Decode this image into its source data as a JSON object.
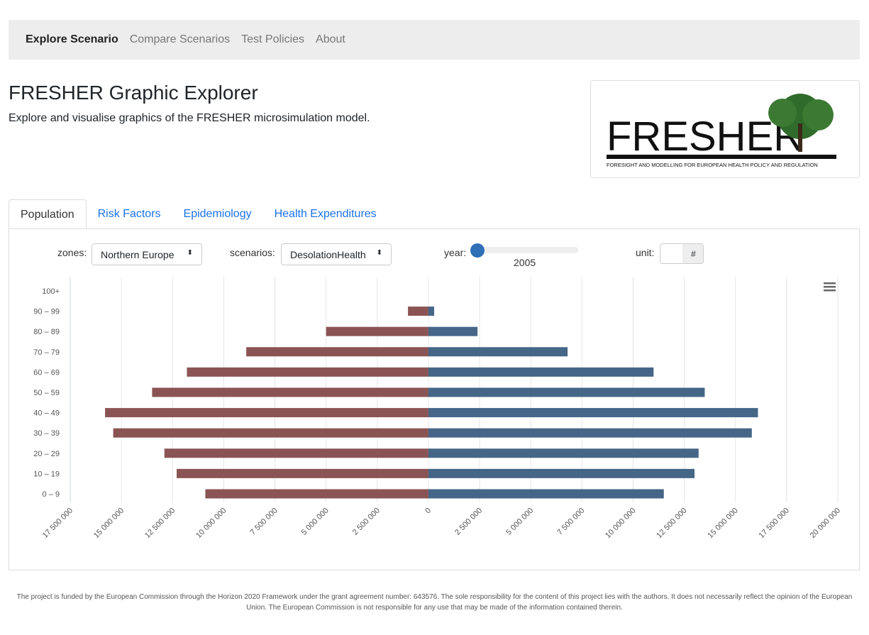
{
  "nav": {
    "items": [
      {
        "label": "Explore Scenario",
        "active": true
      },
      {
        "label": "Compare Scenarios"
      },
      {
        "label": "Test Policies"
      },
      {
        "label": "About"
      }
    ]
  },
  "header": {
    "title": "FRESHER Graphic Explorer",
    "subtitle": "Explore and visualise graphics of the FRESHER microsimulation model.",
    "logo_text": "FRESHER",
    "logo_tagline": "FORESIGHT AND MODELLING FOR EUROPEAN HEALTH POLICY AND REGULATION"
  },
  "tabs": [
    {
      "label": "Population",
      "active": true
    },
    {
      "label": "Risk Factors"
    },
    {
      "label": "Epidemiology"
    },
    {
      "label": "Health Expenditures"
    }
  ],
  "controls": {
    "zones_label": "zones:",
    "zones_value": "Northern Europe",
    "scenarios_label": "scenarios:",
    "scenarios_value": "DesolationHealth",
    "year_label": "year:",
    "year_value": "2005",
    "unit_label": "unit:",
    "unit_value": "#"
  },
  "colors": {
    "left": "#8b5454",
    "right": "#456687"
  },
  "chart_data": {
    "type": "bar",
    "orientation": "horizontal",
    "stacked": "population-pyramid",
    "categories": [
      "100+",
      "90 – 99",
      "80 – 89",
      "70 – 79",
      "60 – 69",
      "50 – 59",
      "40 – 49",
      "30 – 39",
      "20 – 29",
      "10 – 19",
      "0 – 9"
    ],
    "series": [
      {
        "values": [
          0,
          -1000000,
          -5000000,
          -8900000,
          -11800000,
          -13500000,
          -15800000,
          -15400000,
          -12900000,
          -12300000,
          -10900000
        ]
      },
      {
        "values": [
          0,
          280000,
          2400000,
          6800000,
          11000000,
          13500000,
          16100000,
          15800000,
          13200000,
          13000000,
          11500000
        ]
      }
    ],
    "xlim": [
      -17500000,
      20000000
    ],
    "xticks": [
      -17500000,
      -15000000,
      -12500000,
      -10000000,
      -7500000,
      -5000000,
      -2500000,
      0,
      2500000,
      5000000,
      7500000,
      10000000,
      12500000,
      15000000,
      17500000,
      20000000
    ],
    "xtick_labels": [
      "17 500 000",
      "15 000 000",
      "12 500 000",
      "10 000 000",
      "7 500 000",
      "5 000 000",
      "2 500 000",
      "0",
      "2 500 000",
      "5 000 000",
      "7 500 000",
      "10 000 000",
      "12 500 000",
      "15 000 000",
      "17 500 000",
      "20 000 000"
    ],
    "grid": true
  },
  "footer": "The project is funded by the European Commission through the Horizon 2020 Framework under the grant agreement number: 643576. The sole responsibility for the content of this project lies with the authors. It does not necessarily reflect the opinion of the European Union. The European Commission is not responsible for any use that may be made of the information contained therein."
}
